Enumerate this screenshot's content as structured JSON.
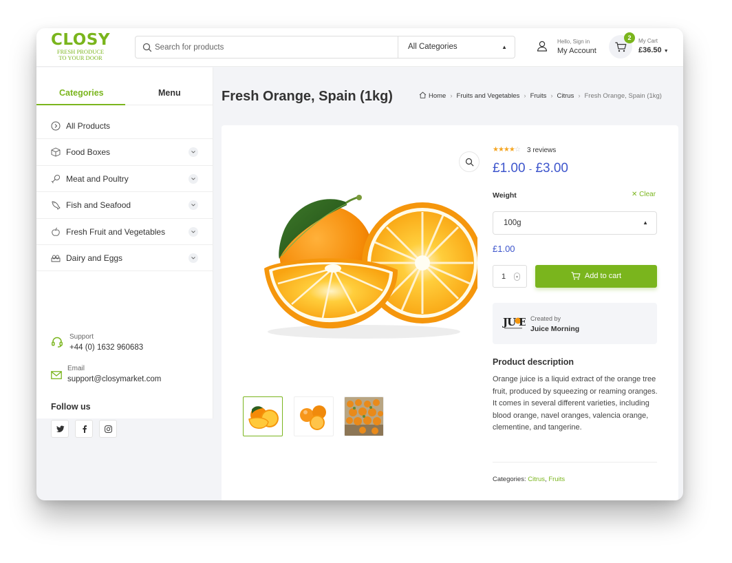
{
  "header": {
    "logo": {
      "word": "CLOSY",
      "tagline_1": "FRESH PRODUCE",
      "tagline_2": "TO YOUR DOOR"
    },
    "search": {
      "placeholder": "Search for products",
      "category": "All Categories"
    },
    "account": {
      "greeting": "Hello, Sign in",
      "label": "My Account"
    },
    "cart": {
      "count": "2",
      "label": "My Cart",
      "total": "£36.50"
    }
  },
  "sidebar": {
    "tabs": [
      {
        "label": "Categories",
        "active": true
      },
      {
        "label": "Menu",
        "active": false
      }
    ],
    "categories": [
      {
        "label": "All Products",
        "icon": "circle-chevron-icon",
        "has_children": false
      },
      {
        "label": "Food Boxes",
        "icon": "box-icon",
        "has_children": true
      },
      {
        "label": "Meat and Poultry",
        "icon": "drumstick-icon",
        "has_children": true
      },
      {
        "label": "Fish and Seafood",
        "icon": "fish-icon",
        "has_children": true
      },
      {
        "label": "Fresh Fruit and Vegetables",
        "icon": "apple-icon",
        "has_children": true
      },
      {
        "label": "Dairy and Eggs",
        "icon": "eggs-icon",
        "has_children": true
      }
    ],
    "support": {
      "label": "Support",
      "phone": "+44 (0) 1632 960683"
    },
    "email": {
      "label": "Email",
      "address": "support@closymarket.com"
    },
    "follow": {
      "label": "Follow us",
      "networks": [
        "twitter",
        "facebook",
        "instagram"
      ]
    }
  },
  "page": {
    "title": "Fresh Orange, Spain (1kg)",
    "breadcrumb": [
      "Home",
      "Fruits and Vegetables",
      "Fruits",
      "Citrus",
      "Fresh Orange, Spain (1kg)"
    ]
  },
  "product": {
    "rating": 4,
    "rating_max": 5,
    "reviews": "3 reviews",
    "price_min": "£1.00",
    "price_max": "£3.00",
    "price_sep": "-",
    "weight_label": "Weight",
    "clear_label": "Clear",
    "weight_selected": "100g",
    "variation_price": "£1.00",
    "quantity": "1",
    "add_to_cart": "Add to cart",
    "vendor": {
      "created_by": "Created by",
      "name": "Juice Morning"
    },
    "description_title": "Product description",
    "description": "Orange juice is a liquid extract of the orange tree fruit, produced by squeezing or reaming oranges. It comes in several different varieties, including blood orange, navel oranges, valencia orange, clementine, and tangerine.",
    "categories_label": "Categories:",
    "categories": [
      "Citrus",
      "Fruits"
    ],
    "thumbnails": [
      "orange-halves-thumb",
      "tangerines-thumb",
      "orange-crate-thumb"
    ]
  },
  "colors": {
    "accent": "#7ab51d",
    "price": "#3d55cc",
    "star": "#f5a623"
  }
}
